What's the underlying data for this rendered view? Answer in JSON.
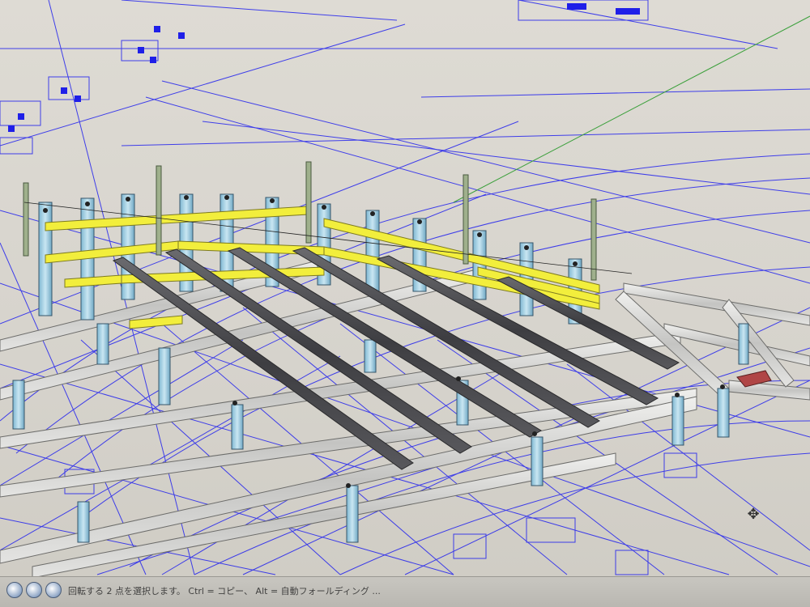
{
  "app": {
    "viewport_label": "",
    "background_color": "#d9d6cf"
  },
  "colors": {
    "guide_lines": "#1f1ff0",
    "axis_green": "#3ca03c",
    "yellow_rail": "#f2ee3c",
    "post_blue": "#8fc4dc",
    "dark_beam": "#5a5a5e",
    "light_beam": "#d6d6d4",
    "red_plate": "#b04646"
  },
  "statusbar": {
    "text": "回転する 2 点を選択します。 Ctrl = コピー、 Alt = 自動フォールディング ...",
    "icons": [
      "geo-location-icon",
      "credits-icon",
      "help-icon"
    ]
  },
  "cursor": {
    "icon": "move-cursor-icon",
    "glyph": "✥"
  }
}
